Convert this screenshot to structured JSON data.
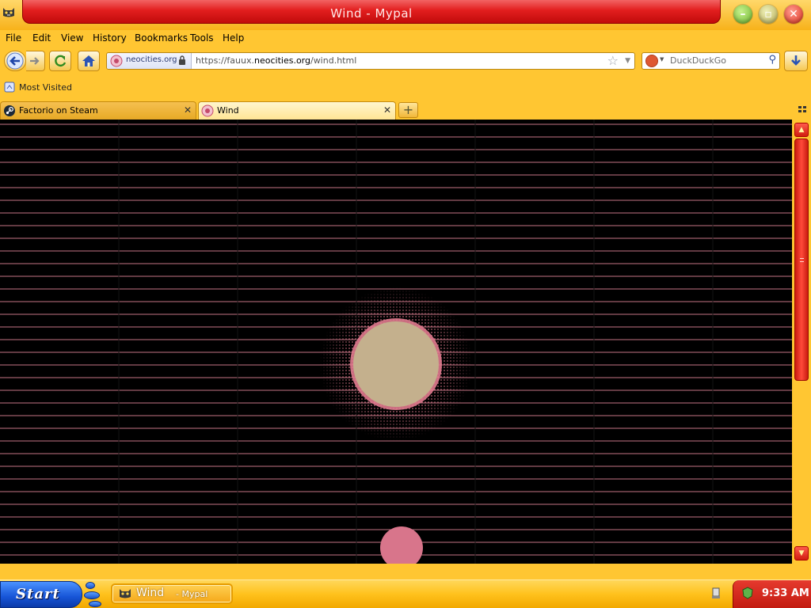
{
  "window": {
    "title": "Wind",
    "title_separator": "-",
    "app_name": "Mypal"
  },
  "menu": [
    "File",
    "Edit",
    "View",
    "History",
    "Bookmarks",
    "Tools",
    "Help"
  ],
  "navigation": {
    "identity_domain": "neocities.org",
    "url_prefix": "https://fauux.",
    "url_host": "neocities.org",
    "url_path": "/wind.html",
    "search_engine": "DuckDuckGo",
    "search_placeholder": "DuckDuckGo"
  },
  "bookmarks_bar": {
    "items": [
      "Most Visited"
    ]
  },
  "tabs": [
    {
      "label": "Factorio on Steam",
      "active": false
    },
    {
      "label": "Wind",
      "active": true
    }
  ],
  "taskbar": {
    "start_label": "Start",
    "window_title": "Wind",
    "window_app": "- Mypal",
    "clock": "9:33 AM"
  },
  "colors": {
    "chrome": "#ffc632",
    "title_red": "#e21e1e",
    "page_background": "#000000",
    "stripe_color": "#e8889b",
    "sun_core": "#c4b08d",
    "sun_glow": "#e07a8e",
    "moon_pink": "#d8758b"
  },
  "icons": {
    "app": "mypal-cat-icon",
    "back": "back-arrow-icon",
    "forward": "forward-arrow-icon",
    "reload": "reload-icon",
    "home": "home-icon",
    "lock": "lock-icon",
    "bookmark": "star-icon",
    "download": "download-icon",
    "search": "magnifier-icon"
  }
}
